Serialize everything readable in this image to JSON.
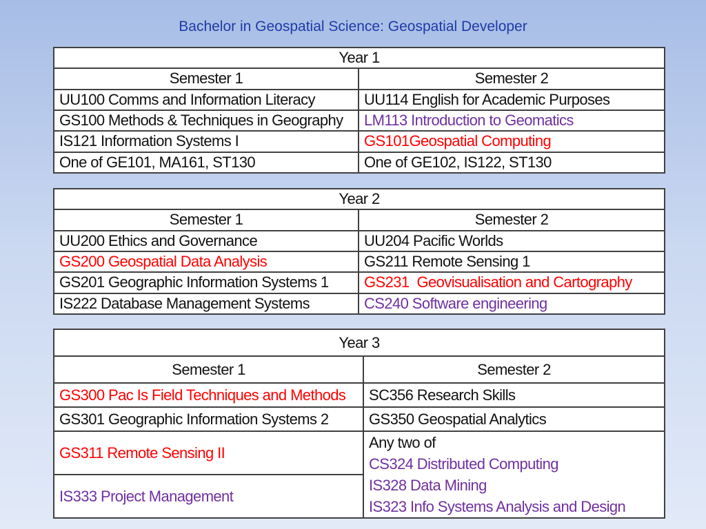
{
  "title": "Bachelor in Geospatial Science: Geospatial Developer",
  "colors": {
    "red": "#ff0000",
    "purple": "#7030a0",
    "title": "#1f3aa8"
  },
  "year1": {
    "label": "Year 1",
    "sem1": "Semester 1",
    "sem2": "Semester 2",
    "rows": [
      [
        "UU100 Comms and Information Literacy",
        "UU114 English for Academic Purposes"
      ],
      [
        "GS100 Methods & Techniques in Geography",
        "LM113 Introduction to Geomatics"
      ],
      [
        "IS121 Information Systems I",
        "GS101Geospatial Computing"
      ],
      [
        "One of GE101, MA161, ST130",
        "One of GE102, IS122, ST130"
      ]
    ]
  },
  "year2": {
    "label": "Year 2",
    "sem1": "Semester 1",
    "sem2": "Semester 2",
    "rows": [
      [
        "UU200 Ethics and Governance",
        "UU204 Pacific Worlds"
      ],
      [
        "GS200 Geospatial Data Analysis",
        "GS211 Remote Sensing 1"
      ],
      [
        "GS201 Geographic Information Systems 1",
        "GS231  Geovisualisation and Cartography"
      ],
      [
        "IS222 Database Management Systems",
        "CS240 Software engineering"
      ]
    ]
  },
  "year3": {
    "label": "Year 3",
    "sem1": "Semester 1",
    "sem2": "Semester 2",
    "rows": [
      [
        "GS300 Pac Is Field Techniques and Methods",
        "SC356 Research Skills"
      ],
      [
        "GS301 Geographic Information Systems 2",
        "GS350 Geospatial Analytics"
      ],
      [
        "GS311 Remote Sensing II"
      ],
      [
        "IS333 Project Management"
      ]
    ],
    "electives": {
      "intro": "Any two of",
      "items": [
        "CS324 Distributed Computing",
        "IS328 Data Mining",
        "IS323 Info Systems Analysis and Design"
      ]
    }
  }
}
